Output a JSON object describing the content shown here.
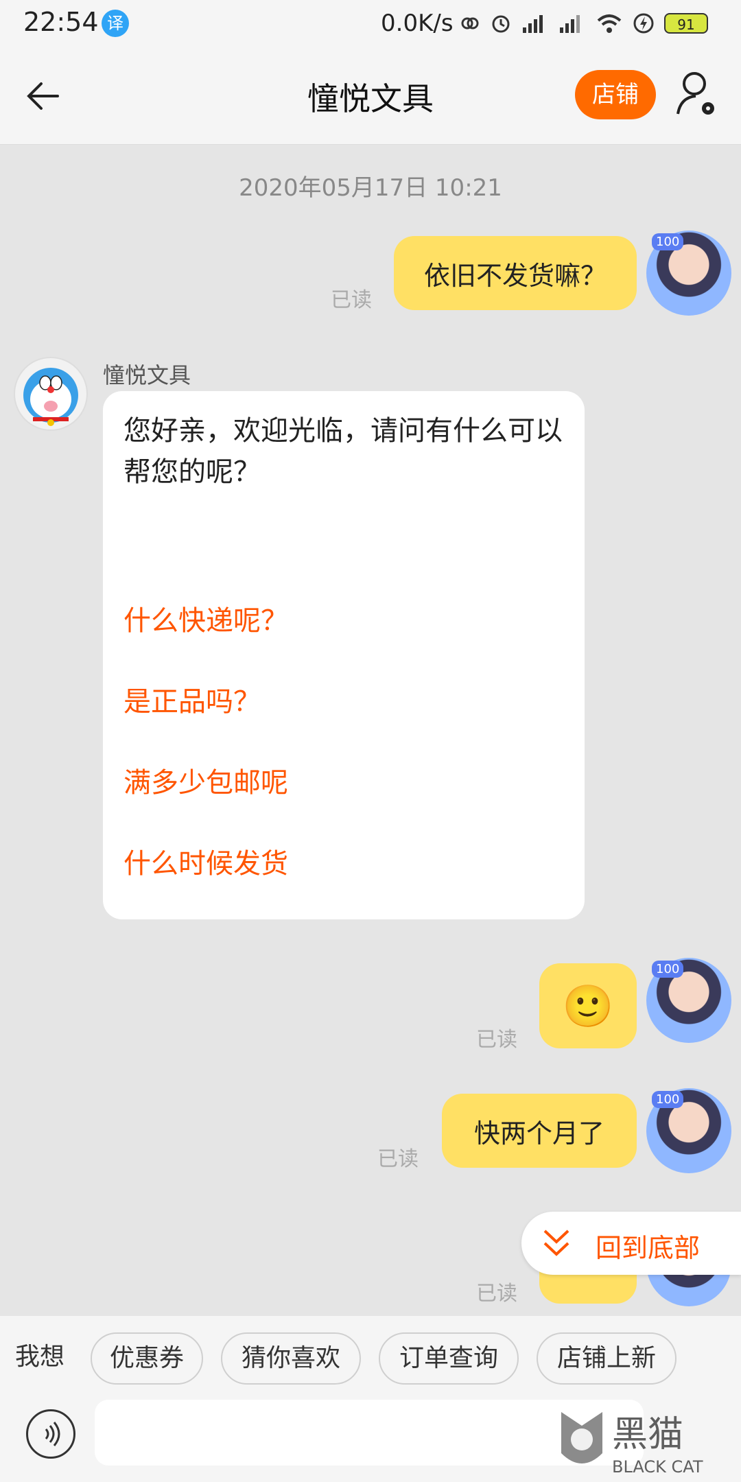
{
  "status_bar": {
    "time": "22:54",
    "app_icon": "译",
    "net_speed": "0.0K/s",
    "battery": "91",
    "icons": [
      "link-icon",
      "alarm-icon",
      "signal-icon",
      "signal-icon",
      "wifi-icon",
      "charging-icon",
      "battery-icon"
    ]
  },
  "header": {
    "title": "憧悦文具",
    "shop_label": "店铺",
    "back_icon": "arrow-left-icon",
    "user_icon": "user-settings-icon"
  },
  "chat": {
    "timestamp": "2020年05月17日 10:21",
    "badge": "100",
    "messages": [
      {
        "from": "me",
        "text": "依旧不发货嘛？",
        "status": "已读"
      },
      {
        "from": "seller",
        "sender": "憧悦文具",
        "greeting": "您好亲，欢迎光临，请问有什么可以帮您的呢？",
        "quick_links": [
          "什么快递呢？",
          "是正品吗？",
          "满多少包邮呢",
          "什么时候发货"
        ]
      },
      {
        "from": "me",
        "text": "🙂",
        "status": "已读"
      },
      {
        "from": "me",
        "text": "快两个月了",
        "status": "已读"
      },
      {
        "from": "me",
        "text": "",
        "status": "已读"
      }
    ]
  },
  "back_to_bottom": "回到底部",
  "quick_bar": {
    "label": "我想",
    "chips": [
      "优惠券",
      "猜你喜欢",
      "订单查询",
      "店铺上新"
    ]
  },
  "input": {
    "placeholder": ""
  },
  "watermark": {
    "text": "黑猫",
    "sub": "BLACK CAT"
  },
  "colors": {
    "accent": "#ff6a00",
    "link": "#ff5500",
    "my_bubble": "#ffe064",
    "bg": "#e5e5e5"
  }
}
